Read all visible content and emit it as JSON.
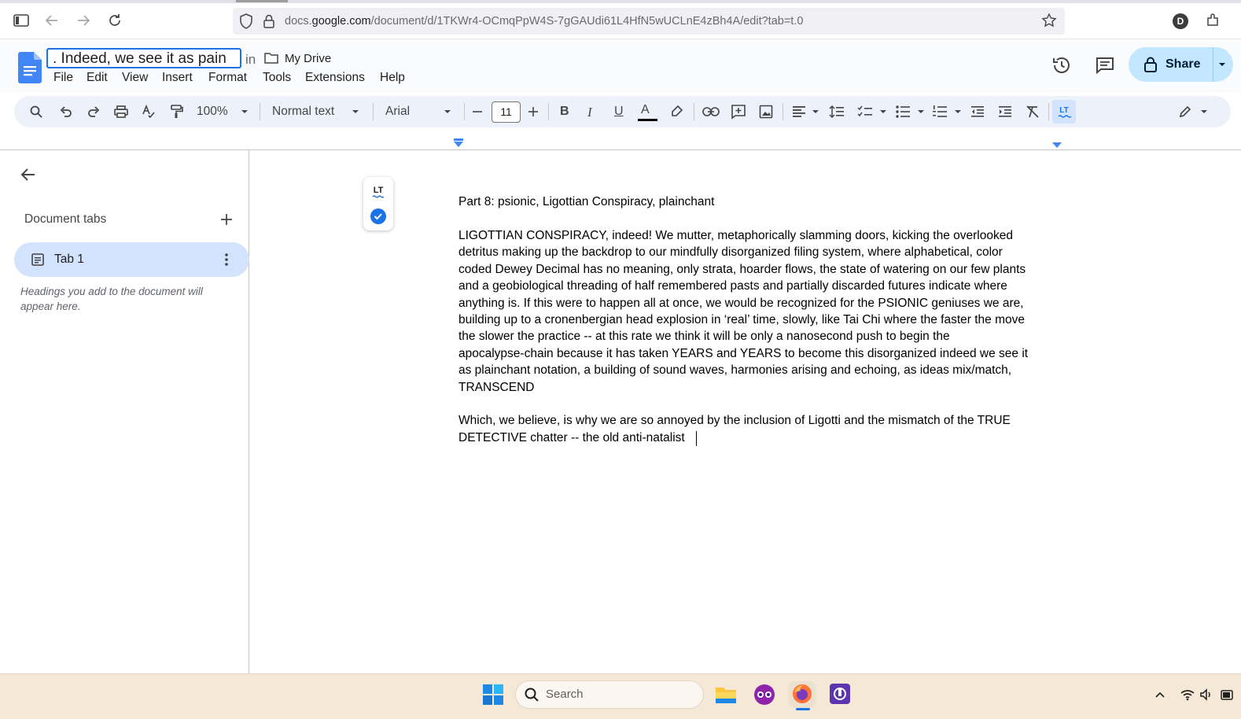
{
  "browser": {
    "url_prefix": "docs.",
    "url_domain": "google.com",
    "url_path": "/document/d/1TKWr4-OCmqPpW4S-7gGAUdi61L4HfN5wUCLnE4zBh4A/edit?tab=t.0",
    "profile_initial": "D"
  },
  "docs": {
    "title_input_value": ". Indeed, we see it as pain",
    "location_prefix": "in",
    "folder": "My Drive",
    "menu": [
      "File",
      "Edit",
      "View",
      "Insert",
      "Format",
      "Tools",
      "Extensions",
      "Help"
    ],
    "share_label": "Share",
    "accent_color": "#1a73e8",
    "share_bg": "#c2e7ff"
  },
  "toolbar": {
    "zoom": "100%",
    "style": "Normal text",
    "font": "Arial",
    "font_size": "11",
    "bold": "B",
    "italic": "I",
    "underline": "U",
    "text_color": "A"
  },
  "sidebar": {
    "heading": "Document tabs",
    "tab_label": "Tab 1",
    "hint": "Headings you add to the document will appear here."
  },
  "document": {
    "lines": [
      "Part 8: psionic, Ligottian Conspiracy, plainchant",
      "LIGOTTIAN CONSPIRACY, indeed! We mutter, metaphorically slamming doors, kicking the overlooked",
      "detritus making up the backdrop to our mindfully disorganized filing system, where alphabetical, color",
      "coded Dewey Decimal has no meaning, only strata, hoarder flows, the state of watering on our few plants",
      "and a geobiological threading of half remembered pasts and partially discarded futures indicate where",
      "anything is. If this were to happen all at once, we would be recognized for the PSIONIC geniuses we are,",
      "building up to a cronenbergian head explosion in ‘real’ time, slowly, like Tai Chi where the faster the move",
      "the slower the practice -- at this rate we think it will be only a nanosecond push to begin the",
      "apocalypse-chain because it has taken YEARS and YEARS to become this disorganized indeed we see it",
      "as plainchant notation, a building of sound waves, harmonies arising and echoing, as ideas mix/match,",
      "TRANSCEND",
      "Which, we believe, is why we are so annoyed by the inclusion of Ligotti and the mismatch of the TRUE",
      "DETECTIVE chatter -- the old anti-natalist"
    ]
  },
  "taskbar": {
    "search_placeholder": "Search"
  }
}
